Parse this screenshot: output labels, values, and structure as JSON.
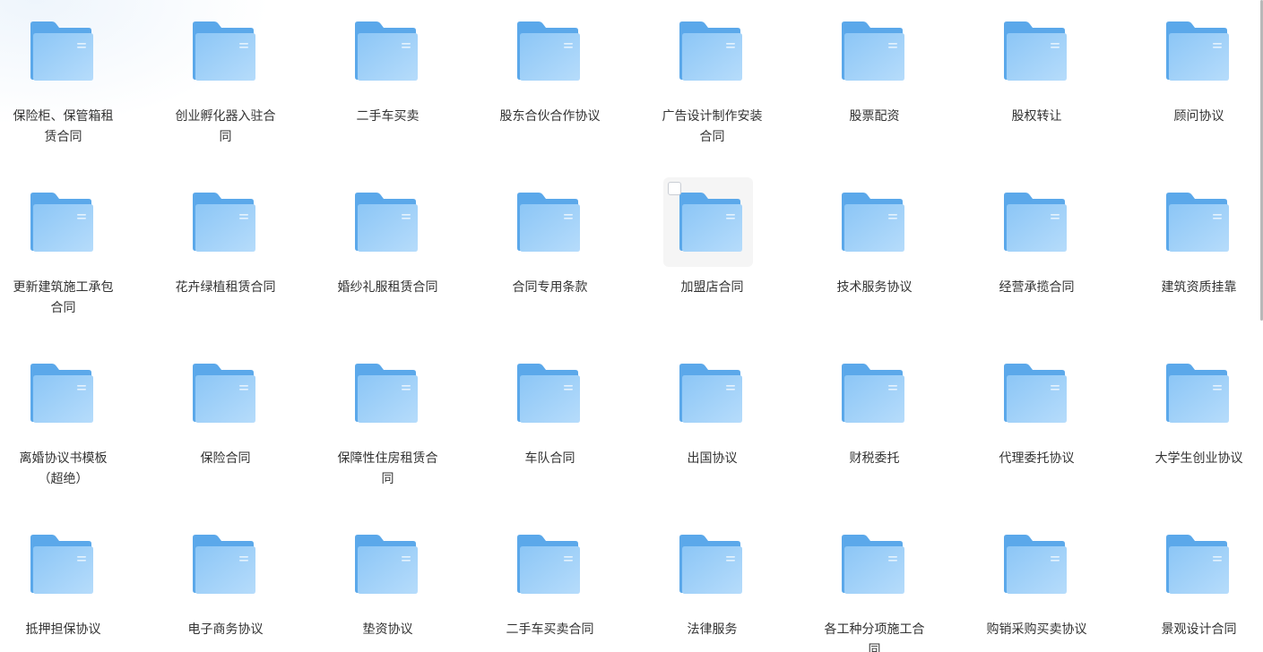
{
  "folders": [
    {
      "name": "保险柜、保管箱租赁合同"
    },
    {
      "name": "创业孵化器入驻合同"
    },
    {
      "name": "二手车买卖"
    },
    {
      "name": "股东合伙合作协议"
    },
    {
      "name": "广告设计制作安装合同"
    },
    {
      "name": "股票配资"
    },
    {
      "name": "股权转让"
    },
    {
      "name": "顾问协议"
    },
    {
      "name": "更新建筑施工承包合同"
    },
    {
      "name": "花卉绿植租赁合同"
    },
    {
      "name": "婚纱礼服租赁合同"
    },
    {
      "name": "合同专用条款"
    },
    {
      "name": "加盟店合同",
      "selected": true
    },
    {
      "name": "技术服务协议"
    },
    {
      "name": "经营承揽合同"
    },
    {
      "name": "建筑资质挂靠"
    },
    {
      "name": "离婚协议书模板（超绝）"
    },
    {
      "name": "保险合同"
    },
    {
      "name": "保障性住房租赁合同"
    },
    {
      "name": "车队合同"
    },
    {
      "name": "出国协议"
    },
    {
      "name": "财税委托"
    },
    {
      "name": "代理委托协议"
    },
    {
      "name": "大学生创业协议"
    },
    {
      "name": "抵押担保协议"
    },
    {
      "name": "电子商务协议"
    },
    {
      "name": "垫资协议"
    },
    {
      "name": "二手车买卖合同"
    },
    {
      "name": "法律服务"
    },
    {
      "name": "各工种分项施工合同"
    },
    {
      "name": "购销采购买卖协议"
    },
    {
      "name": "景观设计合同"
    }
  ],
  "icon": "folder-icon",
  "colors": {
    "folder_back": "#5ba8ea",
    "folder_front_top": "#8cc6f6",
    "folder_front_bottom": "#b3dafb",
    "text": "#333333",
    "selected_bg": "#f5f5f5"
  }
}
